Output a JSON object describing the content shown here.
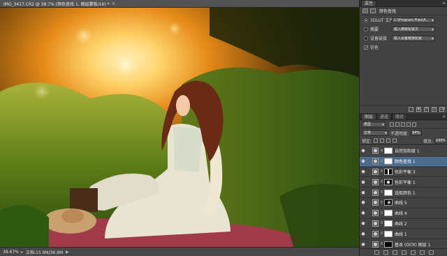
{
  "document": {
    "tab_title": "IMG_3417.CR2 @ 38.7% (颜色查找 1, 图层蒙版/16) *",
    "close_glyph": "×",
    "status_zoom": "38.67%",
    "status_doc": "文档:15.9M/36.9M",
    "status_arrow_glyph": "▸",
    "status_play_glyph": "▶"
  },
  "properties": {
    "tab_label": "属性",
    "panel_menu_glyph": "≡",
    "header_title": "颜色查找",
    "rows": [
      {
        "label": "3DLUT 文件",
        "value": "C:\\Program Files\\A..."
      },
      {
        "label": "摘要",
        "value": "载入摘要配置文"
      },
      {
        "label": "设备链接",
        "value": "载入设备链接配置"
      }
    ],
    "dither_label": "仿色",
    "dither_check_glyph": "✓",
    "footer_glyphs": [
      "⬚",
      "◉",
      "↺",
      "◎",
      "⌫"
    ]
  },
  "layers": {
    "tabs": [
      "图层",
      "通道",
      "路径"
    ],
    "panel_menu_glyph": "≡",
    "filter_label": "类型",
    "blend_mode": "正常",
    "opacity_label": "不透明度:",
    "opacity_value": "94%",
    "lock_label": "锁定:",
    "fill_label": "填充:",
    "fill_value": "100%",
    "eye_glyph": "●",
    "chain_glyph": "8",
    "items": [
      {
        "name": "自然饱和度 1",
        "selected": false,
        "mask": "white"
      },
      {
        "name": "颜色查找 1",
        "selected": true,
        "mask": "white"
      },
      {
        "name": "色彩平衡 3",
        "selected": false,
        "mask": "mixed"
      },
      {
        "name": "色彩平衡 1",
        "selected": false,
        "mask": "dark"
      },
      {
        "name": "选取颜色 1",
        "selected": false,
        "mask": "white"
      },
      {
        "name": "曲线 5",
        "selected": false,
        "mask": "spot"
      },
      {
        "name": "曲线 4",
        "selected": false,
        "mask": "white"
      },
      {
        "name": "曲线 2",
        "selected": false,
        "mask": "white"
      },
      {
        "name": "曲线 1",
        "selected": false,
        "mask": "white"
      },
      {
        "name": "基本 (OCR) 图层 1",
        "selected": false,
        "mask": "black"
      }
    ]
  },
  "colors": {
    "selected_row": "#4c6b8d",
    "panel_bg": "#434343",
    "app_bg": "#2b2b2b"
  },
  "icons": {
    "eye": "eye-icon",
    "chain": "link-icon",
    "close": "close-icon"
  }
}
